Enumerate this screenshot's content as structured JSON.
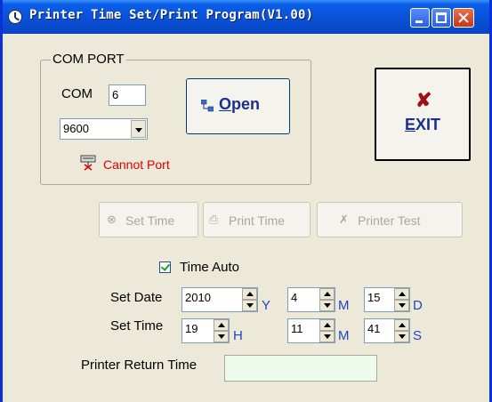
{
  "window": {
    "title": "Printer Time Set/Print Program(V1.00)"
  },
  "com_port": {
    "group_label": "COM PORT",
    "com_label": "COM",
    "com_value": "6",
    "baud_value": "9600",
    "open_label": "Open",
    "status_text": "Cannot Port",
    "status_color": "#e00000"
  },
  "exit": {
    "label": "EXIT"
  },
  "actions": {
    "set_time": "Set Time",
    "print_time": "Print Time",
    "printer_test": "Printer Test"
  },
  "time_auto": {
    "label": "Time Auto",
    "checked": true
  },
  "set_date": {
    "label": "Set Date",
    "year": "2010",
    "year_unit": "Y",
    "month": "4",
    "month_unit": "M",
    "day": "15",
    "day_unit": "D"
  },
  "set_time": {
    "label": "Set Time",
    "hour": "19",
    "hour_unit": "H",
    "minute": "11",
    "minute_unit": "M",
    "second": "41",
    "second_unit": "S"
  },
  "printer_return": {
    "label": "Printer Return Time",
    "value": ""
  },
  "colors": {
    "titlebar": "#0a4fd4",
    "accent_text": "#2044c8",
    "return_field_bg": "#ecfbec"
  }
}
